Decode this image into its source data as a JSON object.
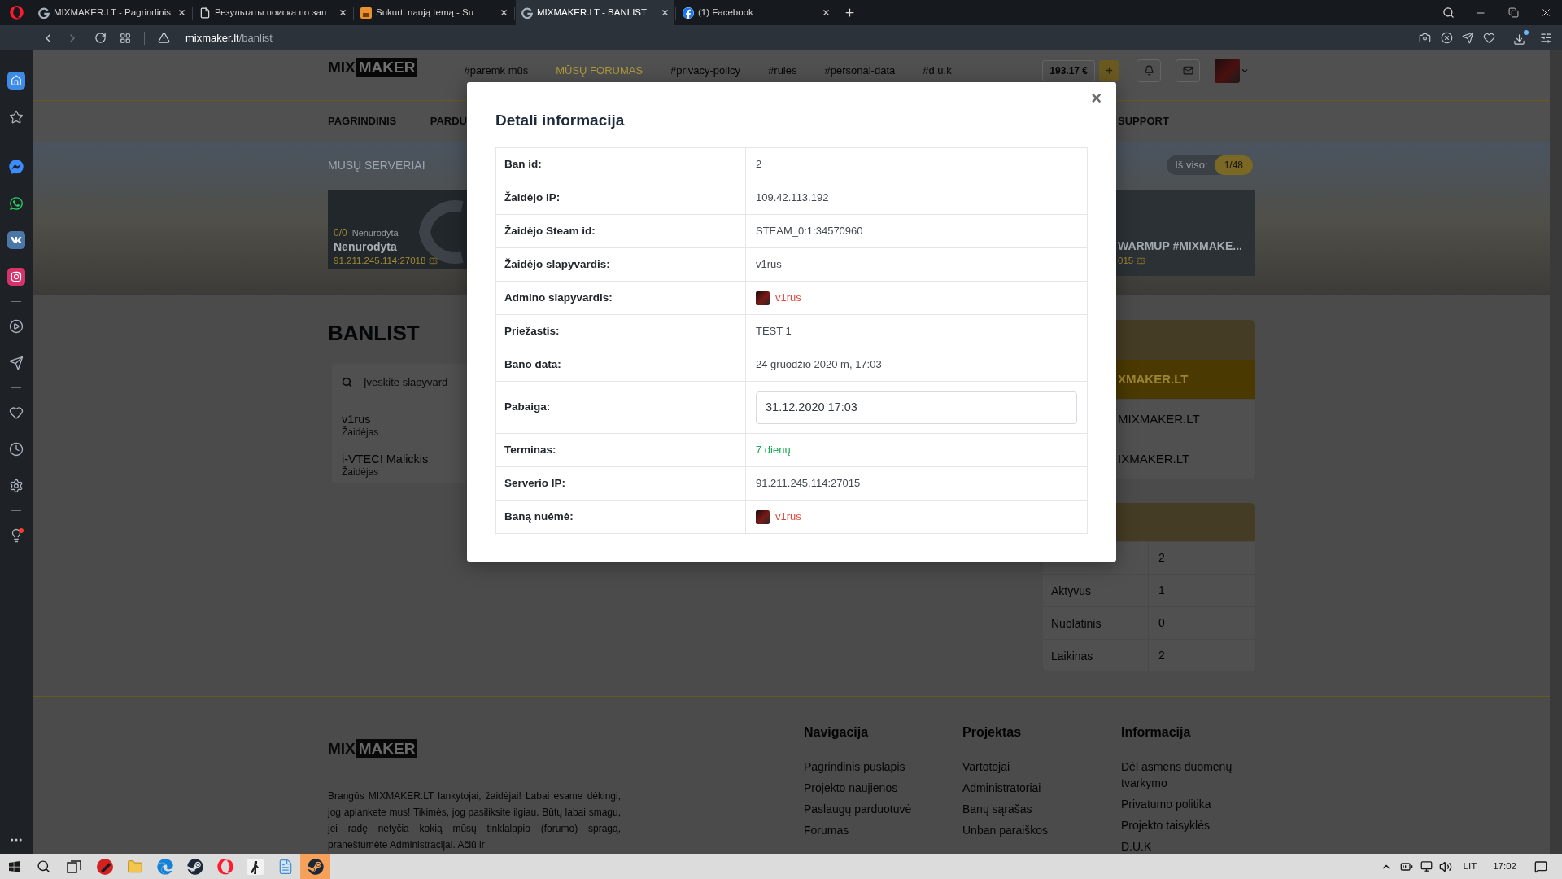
{
  "browser": {
    "tabs": [
      {
        "title": "MIXMAKER.LT - Pagrindinis",
        "selected": false
      },
      {
        "title": "Результаты поиска по зап",
        "selected": false
      },
      {
        "title": "Sukurti naują temą - Su",
        "selected": false
      },
      {
        "title": "MIXMAKER.LT - BANLIST",
        "selected": true
      },
      {
        "title": "(1) Facebook",
        "selected": false
      }
    ],
    "address": {
      "host": "mixmaker.lt",
      "path": "/banlist"
    }
  },
  "sidebar": {
    "items": [
      {
        "selected": true,
        "notify": false
      },
      {
        "selected": false,
        "notify": false
      },
      {
        "selected": false,
        "notify": false
      },
      {
        "selected": false,
        "notify": false
      },
      {
        "selected": false,
        "notify": false
      },
      {
        "selected": false,
        "notify": false
      },
      {
        "selected": false,
        "notify": false
      },
      {
        "selected": false,
        "notify": false
      },
      {
        "selected": false,
        "notify": false
      },
      {
        "selected": false,
        "notify": false
      },
      {
        "selected": false,
        "notify": false
      },
      {
        "selected": false,
        "notify": true
      }
    ]
  },
  "site": {
    "logo": {
      "left": "MIX",
      "right": "MAKER"
    },
    "top_links": [
      {
        "label": "#paremk mūs",
        "highlighted": false
      },
      {
        "label": "MŪSŲ FORUMAS",
        "highlighted": true
      },
      {
        "label": "#privacy-policy",
        "highlighted": false
      },
      {
        "label": "#rules",
        "highlighted": false
      },
      {
        "label": "#personal-data",
        "highlighted": false
      },
      {
        "label": "#d.u.k",
        "highlighted": false
      }
    ],
    "balance": "193.17 €",
    "nav": [
      "PAGRINDINIS",
      "PARDU",
      "SUPPORT"
    ],
    "banner": {
      "title": "MŪSŲ SERVERIAI",
      "total_label": "Iš viso:",
      "total": "1/48",
      "servers": [
        {
          "players": "0/0",
          "map": "Nenurodyta",
          "name": "Nenurodyta",
          "address": "91.211.245.114:27018"
        },
        {
          "name": "WARMUP #MIXMAKE...",
          "address": "015"
        }
      ]
    },
    "heading": "BANLIST",
    "search": {
      "placeholder": "Įveskite slapyvard"
    },
    "players": [
      {
        "name": "v1rus",
        "role": "Žaidėjas"
      },
      {
        "name": "i-VTEC! Malickis",
        "role": "Žaidėjas"
      }
    ],
    "servers_card": {
      "rows": [
        {
          "label": "XMAKER.LT",
          "selected": true
        },
        {
          "label": "MIXMAKER.LT",
          "selected": false
        },
        {
          "label": "IXMAKER.LT",
          "selected": false
        }
      ]
    },
    "stats": {
      "rows": [
        {
          "value": "2"
        },
        {
          "label": "Aktyvus",
          "value": "1"
        },
        {
          "label": "Nuolatinis",
          "value": "0"
        },
        {
          "label": "Laikinas",
          "value": "2"
        }
      ]
    },
    "footer": {
      "logo": {
        "left": "MIX",
        "right": "MAKER"
      },
      "text": "Brangūs MIXMAKER.LT lankytojai, žaidėjai! Labai esame dėkingi, jog aplankete mus! Tikimės, jog pasiliksite ilgiau. Būtų labai smagu, jei radę netyčia kokią mūsų tinklalapio (forumo) spragą, praneštumėte Administracijai. Ačiū ir",
      "columns": [
        {
          "title": "Navigacija",
          "links": [
            "Pagrindinis puslapis",
            "Projekto naujienos",
            "Paslaugų parduotuvė",
            "Forumas"
          ]
        },
        {
          "title": "Projektas",
          "links": [
            "Vartotojai",
            "Administratoriai",
            "Banų sąrašas",
            "Unban paraiškos"
          ]
        },
        {
          "title": "Informacija",
          "links": [
            "Dėl asmens duomenų tvarkymo",
            "Privatumo politika",
            "Projekto taisyklės",
            "D.U.K"
          ]
        }
      ]
    }
  },
  "modal": {
    "title": "Detali informacija",
    "close": "×",
    "rows": [
      {
        "label": "Ban id:",
        "value": "2",
        "kind": "text"
      },
      {
        "label": "Žaidėjo IP:",
        "value": "109.42.113.192",
        "kind": "text"
      },
      {
        "label": "Žaidėjo Steam id:",
        "value": "STEAM_0:1:34570960",
        "kind": "text"
      },
      {
        "label": "Žaidėjo slapyvardis:",
        "value": "v1rus",
        "kind": "text"
      },
      {
        "label": "Admino slapyvardis:",
        "value": "v1rus",
        "kind": "user"
      },
      {
        "label": "Priežastis:",
        "value": "TEST 1",
        "kind": "text"
      },
      {
        "label": "Bano data:",
        "value": "24 gruodžio 2020 m, 17:03",
        "kind": "text"
      },
      {
        "label": "Pabaiga:",
        "value": "31.12.2020 17:03",
        "kind": "field"
      },
      {
        "label": "Terminas:",
        "value": "7 dienų",
        "kind": "positive"
      },
      {
        "label": "Serverio IP:",
        "value": "91.211.245.114:27015",
        "kind": "text"
      },
      {
        "label": "Baną nuėmė:",
        "value": "v1rus",
        "kind": "user"
      }
    ]
  },
  "taskbar": {
    "apps": [
      {
        "highlighted": false
      },
      {
        "highlighted": false
      },
      {
        "highlighted": false
      },
      {
        "highlighted": false
      },
      {
        "highlighted": false
      },
      {
        "highlighted": false
      },
      {
        "highlighted": false
      },
      {
        "highlighted": true
      }
    ],
    "tray": {
      "language": "LIT",
      "time": "17:02"
    }
  }
}
